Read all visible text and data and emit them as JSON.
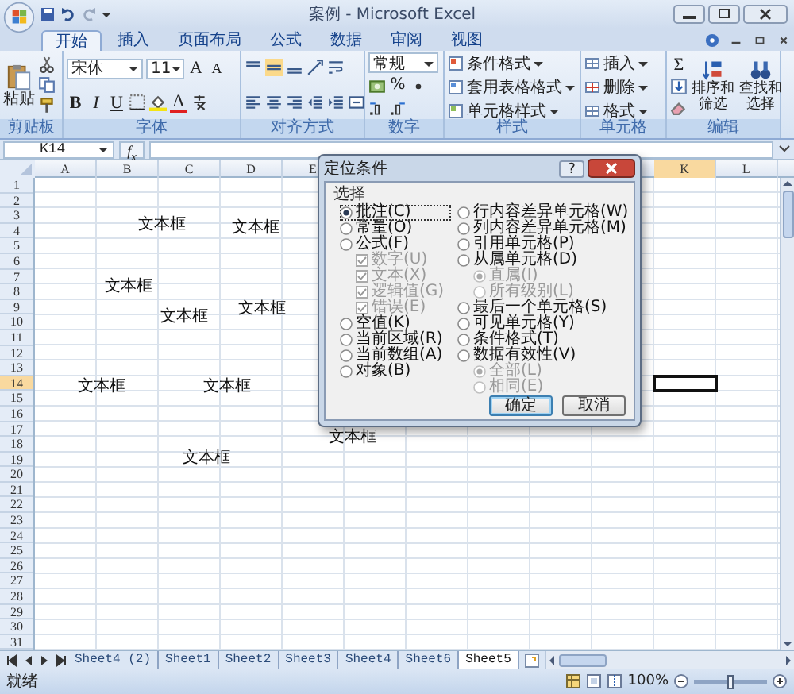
{
  "window": {
    "title": "案例 - Microsoft Excel"
  },
  "ribbon_tabs": [
    {
      "label": "开始",
      "selected": true
    },
    {
      "label": "插入",
      "selected": false
    },
    {
      "label": "页面布局",
      "selected": false
    },
    {
      "label": "公式",
      "selected": false
    },
    {
      "label": "数据",
      "selected": false
    },
    {
      "label": "审阅",
      "selected": false
    },
    {
      "label": "视图",
      "selected": false
    }
  ],
  "clipboard": {
    "paste": "粘贴",
    "label": "剪贴板"
  },
  "font": {
    "name": "宋体",
    "size": "11",
    "grow": "A",
    "shrink": "A",
    "bold": "B",
    "italic": "I",
    "underline": "U",
    "font_color_letter": "A",
    "label": "字体"
  },
  "alignment": {
    "label": "对齐方式"
  },
  "number": {
    "format": "常规",
    "percent": "%",
    "label": "数字"
  },
  "styles": {
    "items": [
      "条件格式",
      "套用表格格式",
      "单元格样式"
    ],
    "label": "样式"
  },
  "cells": {
    "items": [
      "插入",
      "删除",
      "格式"
    ],
    "label": "单元格"
  },
  "editing": {
    "sum": "Σ",
    "sort": "排序和筛选",
    "find": "查找和选择",
    "label": "编辑"
  },
  "formula_bar": {
    "name_box": "K14",
    "fx": "f$_{x}$"
  },
  "columns": [
    {
      "label": "A",
      "selected": false
    },
    {
      "label": "B",
      "selected": false
    },
    {
      "label": "C",
      "selected": false
    },
    {
      "label": "D",
      "selected": false
    },
    {
      "label": "E",
      "selected": false
    },
    {
      "label": "K",
      "selected": true
    },
    {
      "label": "L",
      "selected": false
    }
  ],
  "rows": [
    {
      "label": "1",
      "selected": false
    },
    {
      "label": "2",
      "selected": false
    },
    {
      "label": "3",
      "selected": false
    },
    {
      "label": "4",
      "selected": false
    },
    {
      "label": "5",
      "selected": false
    },
    {
      "label": "6",
      "selected": false
    },
    {
      "label": "7",
      "selected": false
    },
    {
      "label": "8",
      "selected": false
    },
    {
      "label": "9",
      "selected": false
    },
    {
      "label": "10",
      "selected": false
    },
    {
      "label": "11",
      "selected": false
    },
    {
      "label": "12",
      "selected": false
    },
    {
      "label": "13",
      "selected": false
    },
    {
      "label": "14",
      "selected": true
    },
    {
      "label": "15",
      "selected": false
    },
    {
      "label": "16",
      "selected": false
    },
    {
      "label": "17",
      "selected": false
    },
    {
      "label": "18",
      "selected": false
    },
    {
      "label": "19",
      "selected": false
    },
    {
      "label": "20",
      "selected": false
    },
    {
      "label": "21",
      "selected": false
    },
    {
      "label": "22",
      "selected": false
    },
    {
      "label": "23",
      "selected": false
    },
    {
      "label": "24",
      "selected": false
    },
    {
      "label": "25",
      "selected": false
    },
    {
      "label": "26",
      "selected": false
    },
    {
      "label": "27",
      "selected": false
    },
    {
      "label": "28",
      "selected": false
    },
    {
      "label": "29",
      "selected": false
    },
    {
      "label": "30",
      "selected": false
    },
    {
      "label": "31",
      "selected": false
    }
  ],
  "text_boxes": [
    "文本框",
    "文本框",
    "文本框",
    "文本框",
    "文本框",
    "文本框",
    "文本框",
    "文本框",
    "文本框"
  ],
  "dialog": {
    "title": "定位条件",
    "help": "?",
    "group": "选择",
    "left": [
      {
        "kind": "radio",
        "label": "批注(C)",
        "selected": true,
        "focused": true
      },
      {
        "kind": "radio",
        "label": "常量(O)",
        "selected": false,
        "focused": false
      },
      {
        "kind": "radio",
        "label": "公式(F)",
        "selected": false,
        "focused": false,
        "children": [
          {
            "kind": "checkbox",
            "label": "数字(U)",
            "checked": true,
            "disabled": true
          },
          {
            "kind": "checkbox",
            "label": "文本(X)",
            "checked": true,
            "disabled": true
          },
          {
            "kind": "checkbox",
            "label": "逻辑值(G)",
            "checked": true,
            "disabled": true
          },
          {
            "kind": "checkbox",
            "label": "错误(E)",
            "checked": true,
            "disabled": true
          }
        ]
      },
      {
        "kind": "radio",
        "label": "空值(K)",
        "selected": false,
        "focused": false
      },
      {
        "kind": "radio",
        "label": "当前区域(R)",
        "selected": false,
        "focused": false
      },
      {
        "kind": "radio",
        "label": "当前数组(A)",
        "selected": false,
        "focused": false
      },
      {
        "kind": "radio",
        "label": "对象(B)",
        "selected": false,
        "focused": false
      }
    ],
    "right": [
      {
        "kind": "radio",
        "label": "行内容差异单元格(W)",
        "selected": false,
        "focused": false
      },
      {
        "kind": "radio",
        "label": "列内容差异单元格(M)",
        "selected": false,
        "focused": false
      },
      {
        "kind": "radio",
        "label": "引用单元格(P)",
        "selected": false,
        "focused": false
      },
      {
        "kind": "radio",
        "label": "从属单元格(D)",
        "selected": false,
        "focused": false,
        "children": [
          {
            "kind": "radio",
            "label": "直属(I)",
            "selected": true,
            "disabled": true
          },
          {
            "kind": "radio",
            "label": "所有级别(L)",
            "selected": false,
            "disabled": true
          }
        ]
      },
      {
        "kind": "radio",
        "label": "最后一个单元格(S)",
        "selected": false,
        "focused": false
      },
      {
        "kind": "radio",
        "label": "可见单元格(Y)",
        "selected": false,
        "focused": false
      },
      {
        "kind": "radio",
        "label": "条件格式(T)",
        "selected": false,
        "focused": false
      },
      {
        "kind": "radio",
        "label": "数据有效性(V)",
        "selected": false,
        "focused": false,
        "children": [
          {
            "kind": "radio",
            "label": "全部(L)",
            "selected": true,
            "disabled": true
          },
          {
            "kind": "radio",
            "label": "相同(E)",
            "selected": false,
            "disabled": true
          }
        ]
      }
    ],
    "buttons": [
      "确定",
      "取消"
    ]
  },
  "sheet_tabs": [
    {
      "label": "Sheet4 (2)",
      "selected": false
    },
    {
      "label": "Sheet1",
      "selected": false
    },
    {
      "label": "Sheet2",
      "selected": false
    },
    {
      "label": "Sheet3",
      "selected": false
    },
    {
      "label": "Sheet4",
      "selected": false
    },
    {
      "label": "Sheet6",
      "selected": false
    },
    {
      "label": "Sheet5",
      "selected": true
    }
  ],
  "status_bar": {
    "text": "就绪",
    "zoom": "100%",
    "zoom_slider": {
      "level": 0.5
    }
  }
}
